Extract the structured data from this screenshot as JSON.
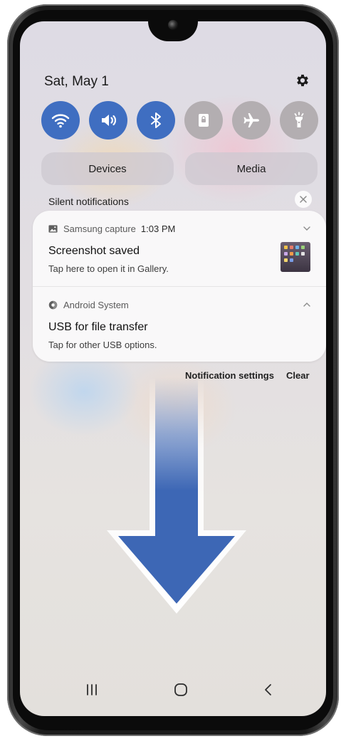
{
  "status": {
    "date": "Sat, May 1"
  },
  "quick_settings": [
    {
      "name": "wifi-icon",
      "state": "on"
    },
    {
      "name": "sound-icon",
      "state": "on"
    },
    {
      "name": "bluetooth-icon",
      "state": "on"
    },
    {
      "name": "lock-icon",
      "state": "off"
    },
    {
      "name": "airplane-icon",
      "state": "off"
    },
    {
      "name": "flashlight-icon",
      "state": "off"
    }
  ],
  "panels": {
    "devices_label": "Devices",
    "media_label": "Media"
  },
  "silent_section": {
    "label": "Silent notifications"
  },
  "notifications": [
    {
      "app": "Samsung capture",
      "time": "1:03 PM",
      "title": "Screenshot saved",
      "body": "Tap here to open it in Gallery.",
      "expanded": false
    },
    {
      "app": "Android System",
      "title": "USB for file transfer",
      "body": "Tap for other USB options.",
      "expanded": true
    }
  ],
  "actions": {
    "settings_label": "Notification settings",
    "clear_label": "Clear"
  },
  "colors": {
    "toggle_on": "#3f6ec1",
    "toggle_off": "#b3aeb1",
    "arrow_fill": "#3d67b5"
  },
  "navigation": {
    "recents": "recents-icon",
    "home": "home-icon",
    "back": "back-icon"
  }
}
